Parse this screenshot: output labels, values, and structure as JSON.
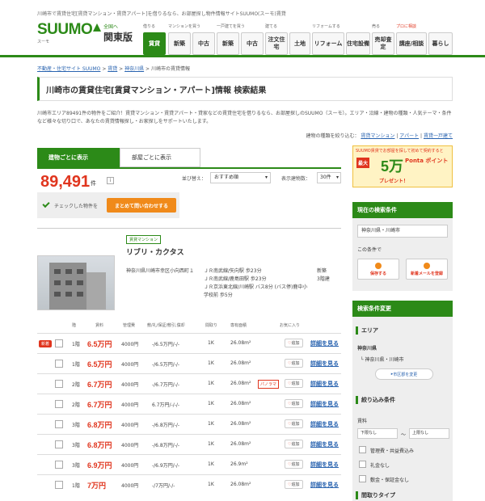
{
  "site": {
    "topline": "川崎市で賃貸住宅[賃貸マンション・賃貸アパート]を借りるなら、お部屋探し物件情報サイトSUUMO(スーモ)賃貸",
    "logo": "SUUMO",
    "logo_sub": "スーモ",
    "region_top": "全国へ",
    "region": "関東版"
  },
  "nav": {
    "groups": [
      "借りる",
      "マンションを買う",
      "一戸建てを買う",
      "建てる",
      "リフォームする",
      "売る",
      "プロに相談"
    ],
    "buttons": [
      "賃貸",
      "新築",
      "中古",
      "新築",
      "中古",
      "注文住宅",
      "土地",
      "リフォーム",
      "住宅設備",
      "売却査定",
      "講座/相談",
      "暮らし"
    ]
  },
  "breadcrumb": [
    "不動産・住宅サイト SUUMO",
    "賃貸",
    "神奈川県",
    "川崎市の賃貸情報"
  ],
  "page_title": "川崎市の賃貸住宅[賃貸マンション・アパート]情報 検索結果",
  "description": "川崎市エリア89491件の物件をご紹介！賃貸マンション・賃貸アパート・貸家などの賃貸住宅を借りるなら、お部屋探しのSUUMO（スーモ）。エリア・沿線・建物の種類・人気テーマ・条件など様々な切り口で、あなたの賃貸情報探し・お家探しをサポートいたします。",
  "filter": {
    "label": "建物の種類を絞り込む：",
    "links": [
      "賃貸マンション",
      "アパート",
      "賃貸一戸建て"
    ]
  },
  "tabs": [
    "建物ごとに表示",
    "部屋ごとに表示"
  ],
  "results": {
    "count": "89,491",
    "unit": "件",
    "info": "i",
    "sort_label": "並び替え：",
    "sort_value": "おすすめ順",
    "display_label": "表示建物数：",
    "display_value": "30件"
  },
  "checkbar": {
    "label": "チェックした物件を",
    "button": "まとめて問い合わせする"
  },
  "building": {
    "tag": "賃貸マンション",
    "name": "リブリ・カクタス",
    "address": "神奈川県川崎市幸区小向西町１",
    "access": [
      "ＪＲ南武線/矢向駅 歩23分",
      "ＪＲ南武線/鹿島田駅 歩23分",
      "ＪＲ京浜東北線/川崎駅 バス8分 (バス停)鹿中小学校前 歩5分"
    ],
    "age": [
      "新築",
      "3階建"
    ]
  },
  "table": {
    "headers": [
      "階",
      "賃料",
      "管理費",
      "敷/礼/保証/敷引,償却",
      "間取り",
      "専有面積",
      "お気に入り"
    ],
    "add_label": "追加",
    "detail_label": "詳細を見る",
    "new_label": "新着",
    "pan_label": "パノラマ",
    "rows": [
      {
        "floor": "1階",
        "rent": "6.5万円",
        "mgmt": "4000円",
        "deposit": "-/6.5万円/-/-",
        "layout": "1K",
        "area": "26.08m²",
        "new": true,
        "pan": false
      },
      {
        "floor": "1階",
        "rent": "6.5万円",
        "mgmt": "4000円",
        "deposit": "-/6.5万円/-/-",
        "layout": "1K",
        "area": "26.08m²",
        "new": false,
        "pan": false
      },
      {
        "floor": "2階",
        "rent": "6.7万円",
        "mgmt": "4000円",
        "deposit": "-/6.7万円/-/-",
        "layout": "1K",
        "area": "26.08m²",
        "new": false,
        "pan": true
      },
      {
        "floor": "2階",
        "rent": "6.7万円",
        "mgmt": "4000円",
        "deposit": "6.7万円/-/-/-",
        "layout": "1K",
        "area": "26.08m²",
        "new": false,
        "pan": false
      },
      {
        "floor": "3階",
        "rent": "6.8万円",
        "mgmt": "4000円",
        "deposit": "-/6.8万円/-/-",
        "layout": "1K",
        "area": "26.08m²",
        "new": false,
        "pan": false
      },
      {
        "floor": "3階",
        "rent": "6.8万円",
        "mgmt": "4000円",
        "deposit": "-/6.8万円/-/-",
        "layout": "1K",
        "area": "26.08m²",
        "new": false,
        "pan": false
      },
      {
        "floor": "3階",
        "rent": "6.9万円",
        "mgmt": "4000円",
        "deposit": "-/6.9万円/-/-",
        "layout": "1K",
        "area": "26.9m²",
        "new": false,
        "pan": false
      },
      {
        "floor": "1階",
        "rent": "7万円",
        "mgmt": "4000円",
        "deposit": "-/7万円/-/-",
        "layout": "1K",
        "area": "26.08m²",
        "new": false,
        "pan": false
      }
    ]
  },
  "ad": {
    "top": "SUUMO賃貸でお部屋を探して初めて契約すると",
    "max": "最大",
    "big": "5万",
    "points": "Ponta ポイント",
    "present": "プレゼント！"
  },
  "sidebar": {
    "current_title": "現在の検索条件",
    "current_value": "神奈川県・川崎市",
    "this_condition": "この条件で",
    "save_label": "保存する",
    "mail_label": "新着メールを登録",
    "change_title": "検索条件変更",
    "area_title": "エリア",
    "pref": "神奈川県",
    "city": "└ 神奈川県・川崎市",
    "city_change": "市区郡を変更",
    "narrow_title": "絞り込み条件",
    "rent_label": "賃料",
    "rent_min": "下限なし",
    "rent_sep": "～",
    "rent_max": "上限なし",
    "checks": [
      "管理費・共益費込み",
      "礼金なし",
      "敷金・保証金なし"
    ],
    "layout_title": "間取りタイプ"
  },
  "colors": {
    "brand": "#2c8a18",
    "accent": "#e0351e",
    "cta": "#f08a1a",
    "link": "#2a64b0"
  }
}
